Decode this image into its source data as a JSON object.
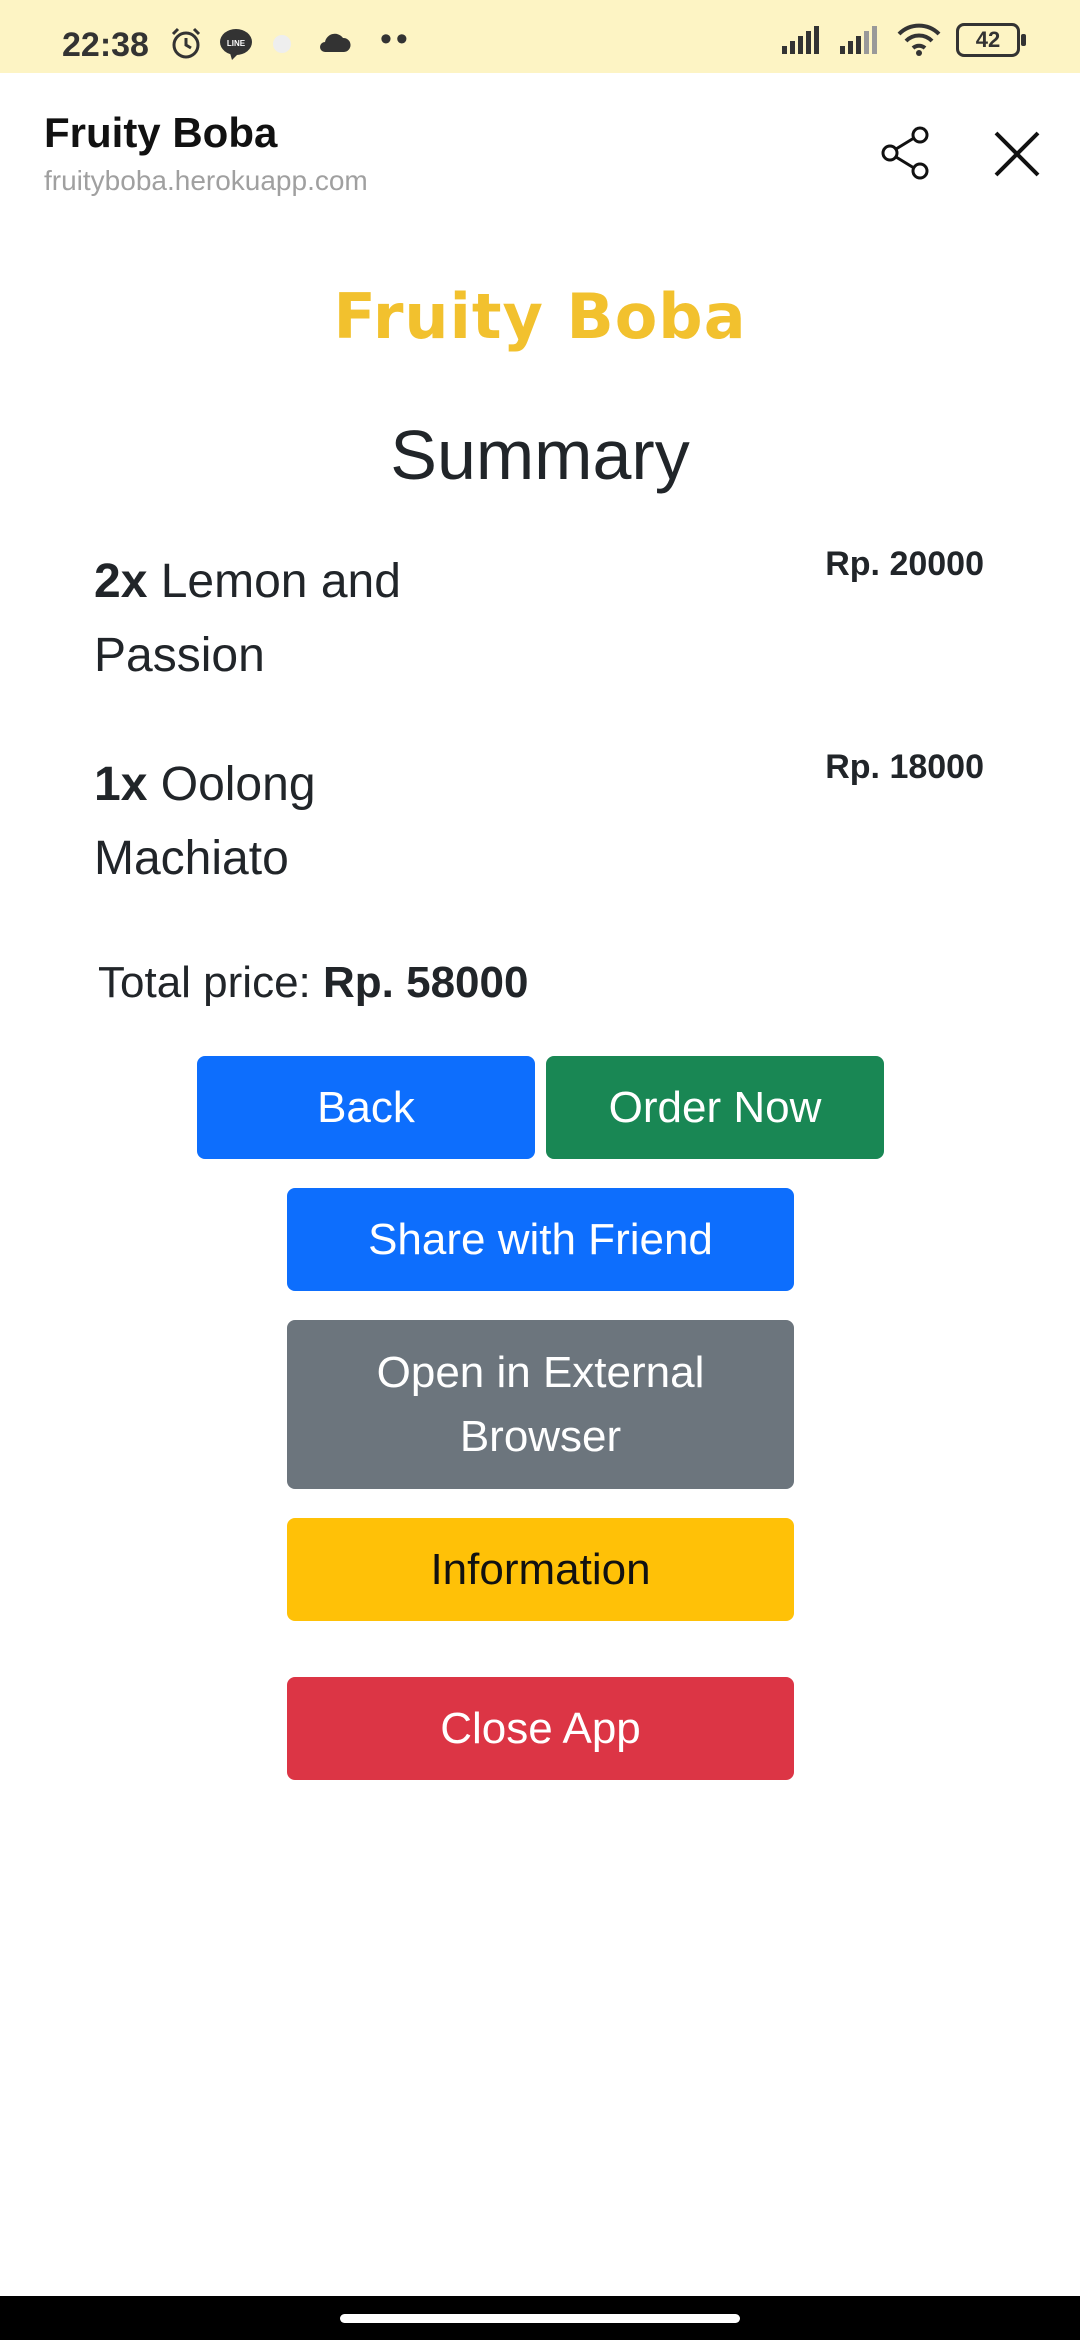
{
  "status_bar": {
    "time": "22:38",
    "battery": "42",
    "icons": [
      "alarm-icon",
      "line-icon",
      "cloud-icon",
      "signal-icon",
      "signal-icon",
      "wifi-icon",
      "battery-icon"
    ],
    "dots": "••"
  },
  "browser": {
    "title": "Fruity Boba",
    "url": "fruityboba.herokuapp.com"
  },
  "page": {
    "brand": "Fruity Boba",
    "heading": "Summary",
    "items": [
      {
        "qty": "2x",
        "name": "Lemon and Passion",
        "price": "Rp. 20000"
      },
      {
        "qty": "1x",
        "name": "Oolong Machiato",
        "price": "Rp. 18000"
      }
    ],
    "total_label": "Total price:",
    "total_value": "Rp. 58000",
    "buttons": {
      "back": "Back",
      "order": "Order Now",
      "share": "Share with Friend",
      "external": "Open in External Browser",
      "info": "Information",
      "close": "Close App"
    }
  },
  "colors": {
    "brand": "#f2c12e",
    "primary": "#0d6efd",
    "success": "#198754",
    "secondary": "#6c757d",
    "warning": "#ffc107",
    "danger": "#dc3545",
    "status_bar": "#fdf4c4"
  }
}
